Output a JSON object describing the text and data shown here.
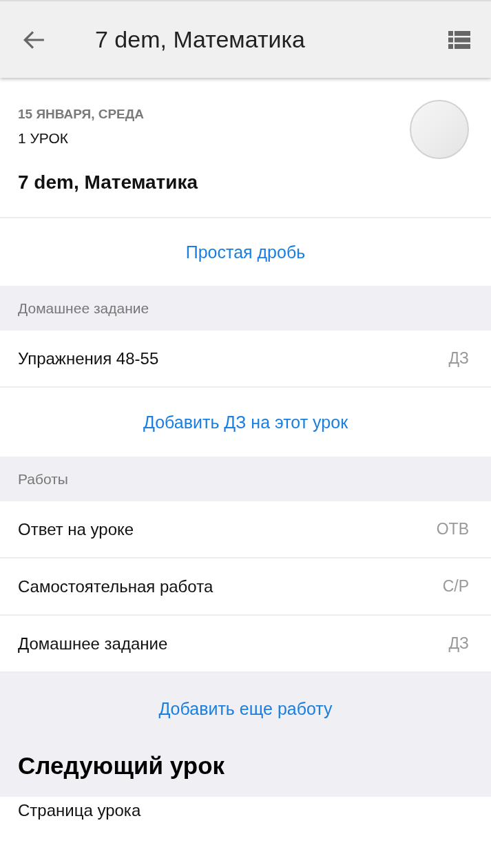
{
  "toolbar": {
    "title": "7 dem, Математика"
  },
  "lesson": {
    "date": "15 ЯНВАРЯ, СРЕДА",
    "number": "1 УРОК",
    "title": "7 dem, Математика",
    "topic": "Простая дробь"
  },
  "homework": {
    "header": "Домашнее задание",
    "items": [
      {
        "title": "Упражнения 48-55",
        "tag": "ДЗ"
      }
    ],
    "add_link": "Добавить ДЗ на этот урок"
  },
  "works": {
    "header": "Работы",
    "items": [
      {
        "title": "Ответ на уроке",
        "tag": "ОТВ"
      },
      {
        "title": "Самостоятельная работа",
        "tag": "С/Р"
      },
      {
        "title": "Домашнее задание",
        "tag": "ДЗ"
      }
    ],
    "add_link": "Добавить еще работу"
  },
  "next_lesson": {
    "heading": "Следующий урок",
    "items": [
      "Страница урока"
    ]
  }
}
